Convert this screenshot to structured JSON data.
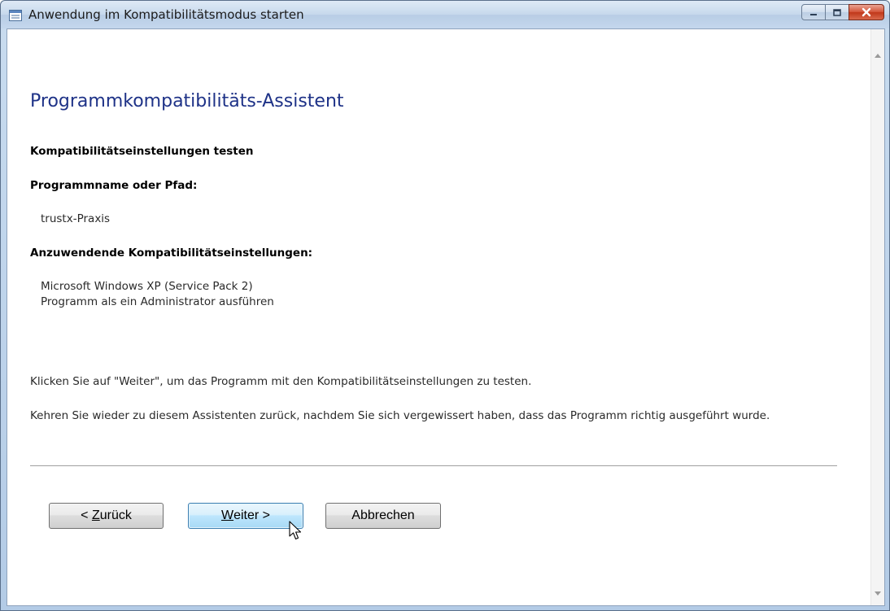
{
  "window": {
    "title": "Anwendung im Kompatibilitätsmodus starten"
  },
  "wizard": {
    "heading": "Programmkompatibilitäts-Assistent",
    "section_title": "Kompatibilitätseinstellungen testen",
    "program_label": "Programmname oder Pfad:",
    "program_value": "trustx-Praxis",
    "settings_label": "Anzuwendende Kompatibilitätseinstellungen:",
    "settings": [
      "Microsoft Windows XP (Service Pack 2)",
      "Programm als ein Administrator ausführen"
    ],
    "instruction_1": "Klicken Sie auf \"Weiter\", um das Programm mit den Kompatibilitätseinstellungen zu testen.",
    "instruction_2": "Kehren Sie wieder zu diesem Assistenten zurück, nachdem Sie sich vergewissert haben, dass das Programm richtig ausgeführt wurde."
  },
  "buttons": {
    "back_prefix": "< ",
    "back_accel": "Z",
    "back_rest": "urück",
    "next_accel": "W",
    "next_rest": "eiter >",
    "cancel": "Abbrechen"
  },
  "icons": {
    "title_icon": "window-app-icon",
    "minimize": "minimize-icon",
    "maximize": "maximize-icon",
    "close": "close-icon",
    "cursor": "mouse-cursor-icon"
  },
  "colors": {
    "heading": "#1e3287",
    "close_button": "#c0381a",
    "hover_button": "#bee6fd"
  }
}
